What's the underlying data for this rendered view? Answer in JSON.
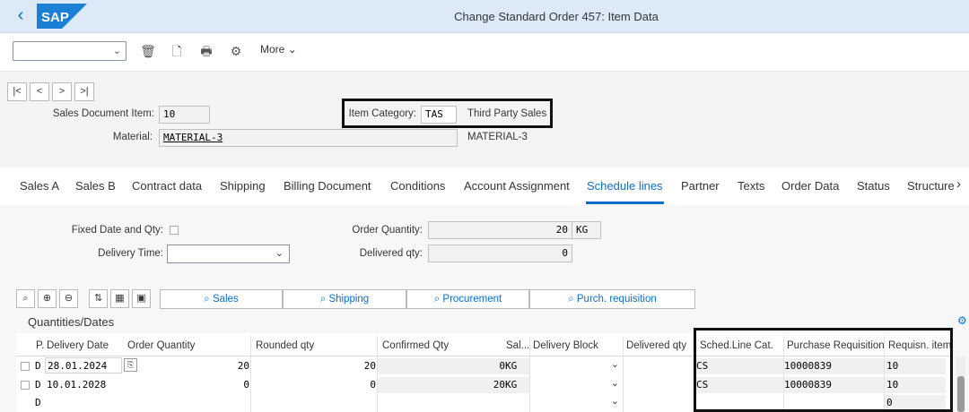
{
  "window": {
    "title": "Change Standard Order 457: Item Data"
  },
  "toolbar": {
    "more_label": "More"
  },
  "header": {
    "sales_doc_item_label": "Sales Document Item:",
    "sales_doc_item_value": "10",
    "item_category_label": "Item Category:",
    "item_category_value": "TAS",
    "item_category_text": "Third Party Sales",
    "material_label": "Material:",
    "material_value": "MATERIAL-3",
    "material_text": "MATERIAL-3"
  },
  "tabs": [
    "Sales A",
    "Sales B",
    "Contract data",
    "Shipping",
    "Billing Document",
    "Conditions",
    "Account Assignment",
    "Schedule lines",
    "Partner",
    "Texts",
    "Order Data",
    "Status",
    "Structure"
  ],
  "schedule": {
    "fixed_date_label": "Fixed Date and Qty:",
    "delivery_time_label": "Delivery Time:",
    "order_qty_label": "Order Quantity:",
    "order_qty_value": "20",
    "order_qty_unit": "KG",
    "delivered_qty_label": "Delivered qty:",
    "delivered_qty_value": "0"
  },
  "buttons": {
    "sales": "Sales",
    "shipping": "Shipping",
    "procurement": "Procurement",
    "purch_req": "Purch. requisition"
  },
  "table": {
    "section_title": "Quantities/Dates",
    "headers": {
      "p": "P.",
      "delivery_date": "Delivery Date",
      "order_qty": "Order Quantity",
      "rounded_qty": "Rounded qty",
      "confirmed_qty": "Confirmed Qty",
      "sal": "Sal...",
      "delivery_block": "Delivery Block",
      "delivered_qty": "Delivered qty",
      "sched_line_cat": "Sched.Line Cat.",
      "purchase_req": "Purchase Requisition",
      "requisn_item": "Requisn. item"
    },
    "rows": [
      {
        "p": "D",
        "date": "28.01.2024",
        "order_qty": "20",
        "rounded": "20",
        "confirmed": "0",
        "unit": "KG",
        "slc": "CS",
        "pr": "10000839",
        "item": "10"
      },
      {
        "p": "D",
        "date": "10.01.2028",
        "order_qty": "0",
        "rounded": "0",
        "confirmed": "20",
        "unit": "KG",
        "slc": "CS",
        "pr": "10000839",
        "item": "10"
      },
      {
        "p": "D",
        "date": "",
        "order_qty": "",
        "rounded": "",
        "confirmed": "",
        "unit": "",
        "slc": "",
        "pr": "",
        "item": "0"
      }
    ]
  }
}
